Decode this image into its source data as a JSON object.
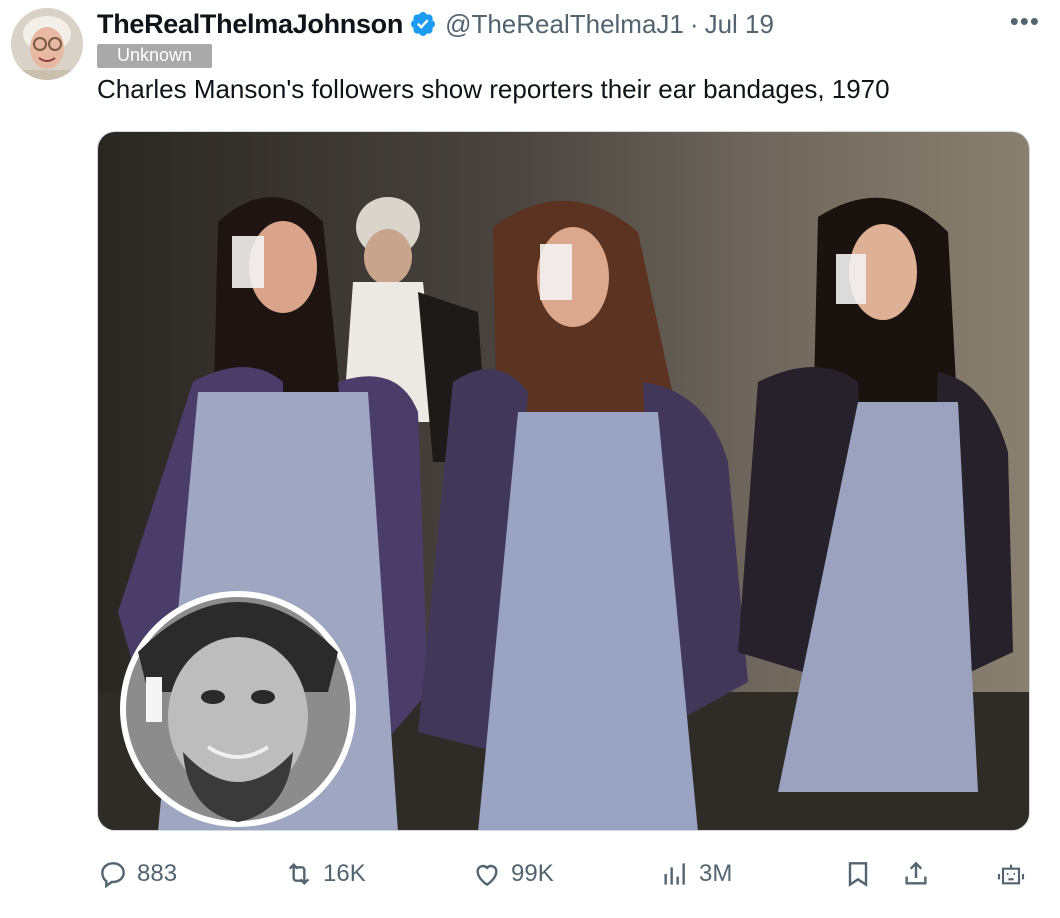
{
  "author": {
    "display_name": "TheRealThelmaJohnson",
    "handle": "@TheRealThelmaJ1",
    "date": "Jul 19",
    "verified": true,
    "avatar_icon": "elderly-woman-avatar"
  },
  "label_badge": "Unknown",
  "tweet_text": "Charles Manson's followers show reporters their ear bandages, 1970",
  "media": {
    "description_icon": "photo-three-women-walking",
    "inset_icon": "man-portrait-inset"
  },
  "actions": {
    "replies": "883",
    "reposts": "16K",
    "likes": "99K",
    "views": "3M"
  },
  "colors": {
    "accent": "#1d9bf0",
    "muted": "#536471",
    "badge": "#a9a9a9"
  }
}
